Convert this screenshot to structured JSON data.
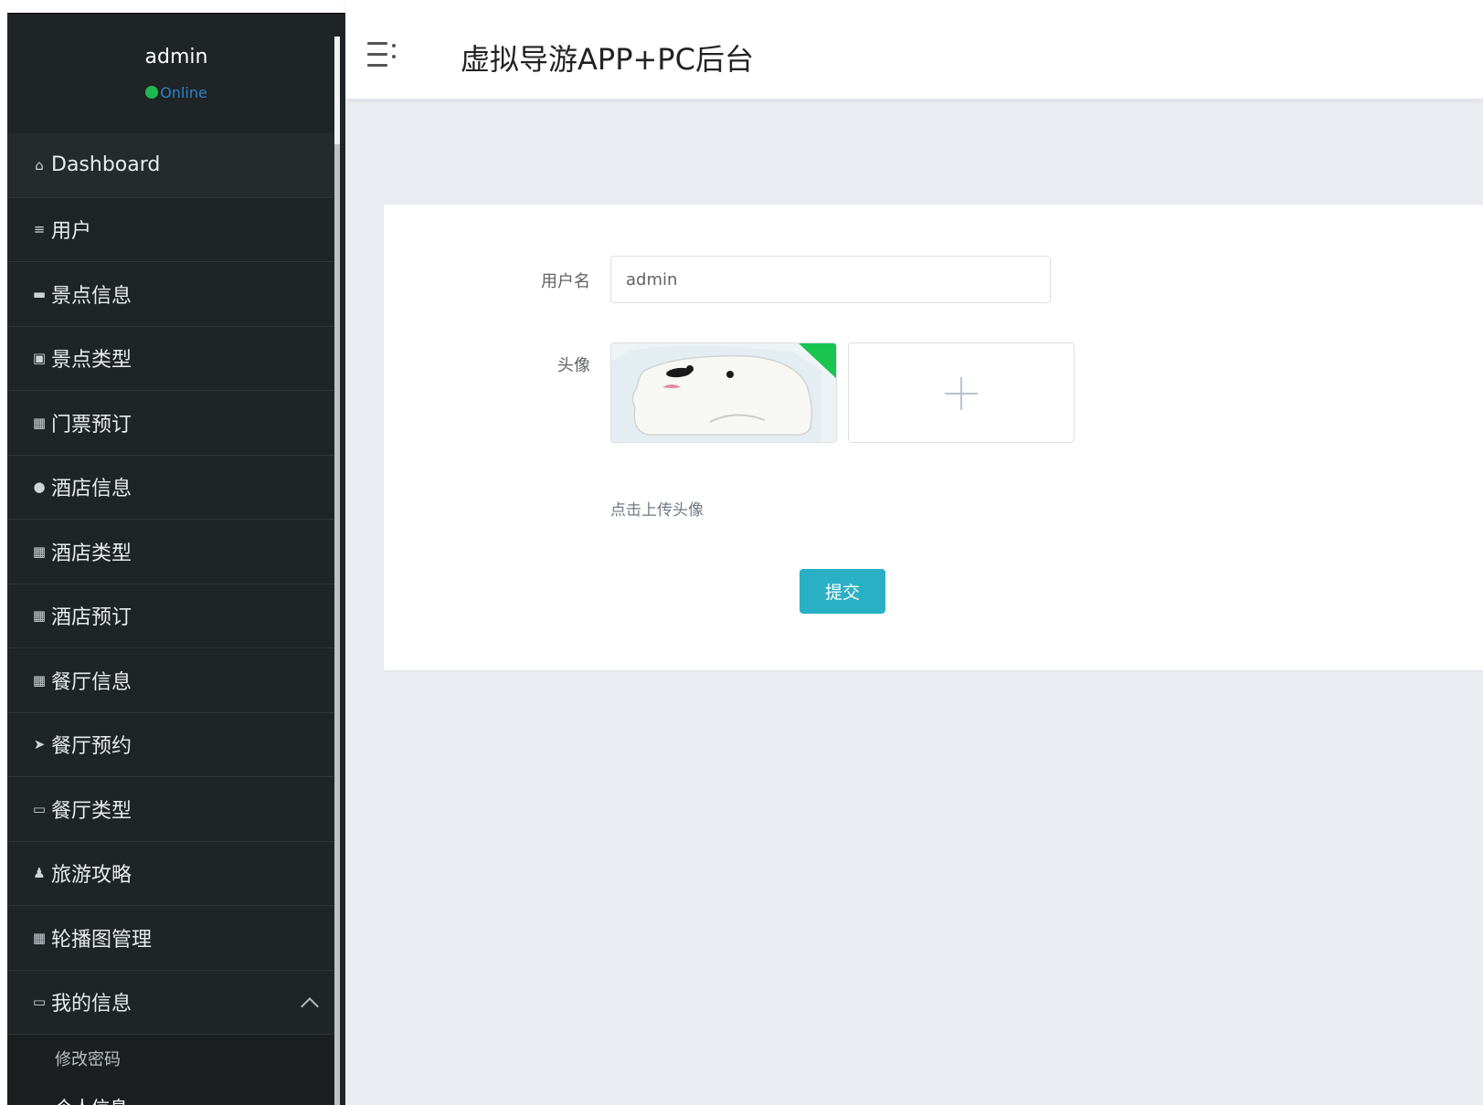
{
  "sidebar": {
    "profile": {
      "name": "admin",
      "status": "Online"
    },
    "items": [
      {
        "label": "Dashboard",
        "icon": "home-icon"
      },
      {
        "label": "用户",
        "icon": "list-icon"
      },
      {
        "label": "景点信息",
        "icon": "briefcase-icon"
      },
      {
        "label": "景点类型",
        "icon": "clipboard-icon"
      },
      {
        "label": "门票预订",
        "icon": "grid-icon"
      },
      {
        "label": "酒店信息",
        "icon": "pin-icon"
      },
      {
        "label": "酒店类型",
        "icon": "grid-icon"
      },
      {
        "label": "酒店预订",
        "icon": "grid-icon"
      },
      {
        "label": "餐厅信息",
        "icon": "grid-icon"
      },
      {
        "label": "餐厅预约",
        "icon": "send-icon"
      },
      {
        "label": "餐厅类型",
        "icon": "monitor-icon"
      },
      {
        "label": "旅游攻略",
        "icon": "user-icon"
      },
      {
        "label": "轮播图管理",
        "icon": "grid-icon"
      },
      {
        "label": "我的信息",
        "icon": "card-icon"
      }
    ],
    "submenu": [
      {
        "label": "修改密码"
      },
      {
        "label": "个人信息"
      }
    ]
  },
  "header": {
    "title": "虚拟导游APP+PC后台"
  },
  "form": {
    "username_label": "用户名",
    "username_value": "admin",
    "avatar_label": "头像",
    "upload_hint": "点击上传头像",
    "submit_label": "提交"
  },
  "colors": {
    "sidebar_bg": "#1f2426",
    "accent": "#2ab0c4",
    "online": "#1fb850",
    "content_bg": "#e9edf2"
  }
}
